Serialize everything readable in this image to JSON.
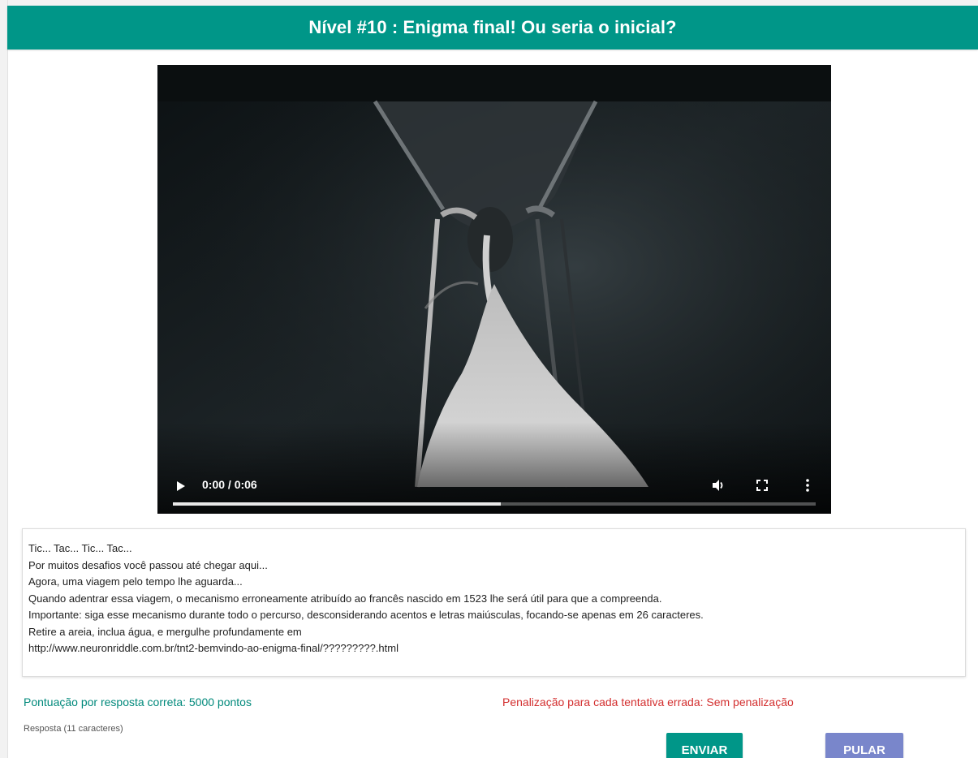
{
  "header": {
    "title": "Nível #10 : Enigma final! Ou seria o inicial?",
    "color": "#009688"
  },
  "video": {
    "time": "0:00 / 0:06",
    "progress_fraction": 0.51,
    "icons": [
      "play-icon",
      "volume-icon",
      "fullscreen-icon",
      "more-vert-icon"
    ]
  },
  "riddle": {
    "lines": [
      "Tic... Tac... Tic... Tac...",
      "Por muitos desafios você passou até chegar aqui...",
      "Agora, uma viagem pelo tempo lhe aguarda...",
      "Quando adentrar essa viagem, o mecanismo erroneamente atribuído ao francês nascido em 1523 lhe será útil para que a compreenda.",
      "Importante: siga esse mecanismo durante todo o percurso, desconsiderando acentos e letras maiúsculas, focando-se apenas em 26 caracteres.",
      "Retire a areia, inclua água, e mergulhe profundamente em",
      "http://www.neuronriddle.com.br/tnt2-bemvindo-ao-enigma-final/?????????.html"
    ]
  },
  "score": {
    "label": "Pontuação por resposta correta: 5000 pontos",
    "color": "#00897b"
  },
  "penalty": {
    "label": "Penalização para cada tentativa errada: Sem penalização",
    "color": "#d32f2f"
  },
  "answer": {
    "label": "Resposta (11 caracteres)"
  },
  "buttons": {
    "send": "ENVIAR",
    "skip": "PULAR",
    "send_color": "#009688",
    "skip_color": "#7986cb"
  }
}
